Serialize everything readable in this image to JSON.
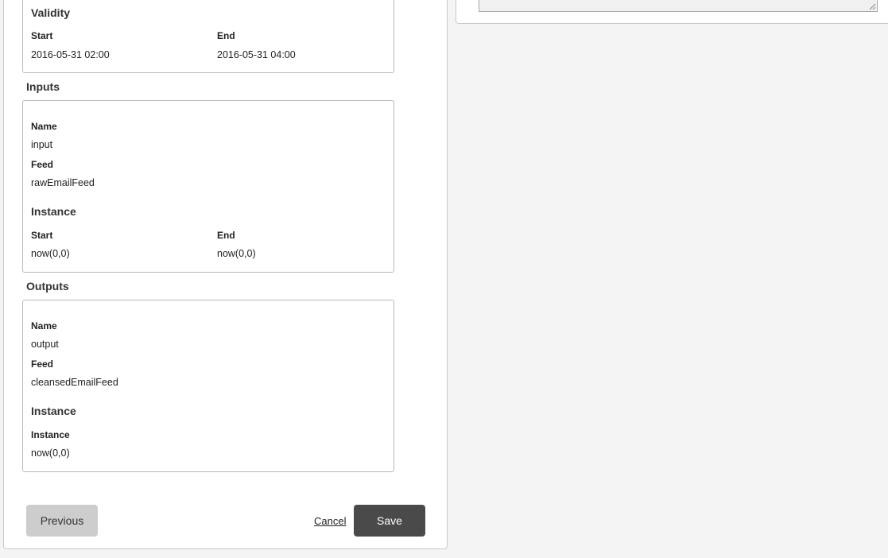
{
  "validity": {
    "title": "Validity",
    "start_label": "Start",
    "end_label": "End",
    "start_value": "2016-05-31 02:00",
    "end_value": "2016-05-31 04:00"
  },
  "inputs": {
    "heading": "Inputs",
    "name_label": "Name",
    "name_value": "input",
    "feed_label": "Feed",
    "feed_value": "rawEmailFeed",
    "instance_title": "Instance",
    "start_label": "Start",
    "start_value": "now(0,0)",
    "end_label": "End",
    "end_value": "now(0,0)"
  },
  "outputs": {
    "heading": "Outputs",
    "name_label": "Name",
    "name_value": "output",
    "feed_label": "Feed",
    "feed_value": "cleansedEmailFeed",
    "instance_title": "Instance",
    "instance_label": "Instance",
    "instance_value": "now(0,0)"
  },
  "footer": {
    "previous_label": "Previous",
    "cancel_label": "Cancel",
    "save_label": "Save"
  }
}
